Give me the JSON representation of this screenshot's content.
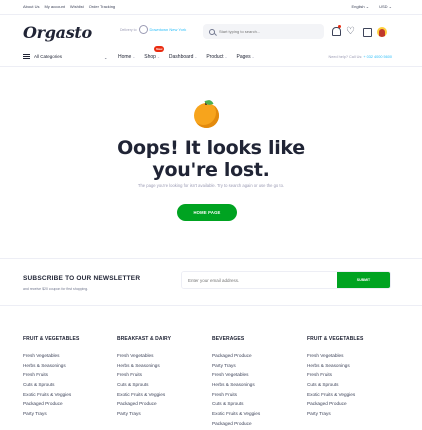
{
  "topbar": {
    "links": [
      "About Us",
      "My account",
      "Wishlist",
      "Order Tracking"
    ],
    "language": "English",
    "currency": "USD"
  },
  "header": {
    "logo": "Orgasto",
    "delivery_label": "Delivery to",
    "delivery_city": "Downtown New York",
    "search_placeholder": "Start typing to search...",
    "avatar_alt": "User avatar"
  },
  "nav": {
    "all_categories": "All Categories",
    "items": [
      {
        "label": "Home",
        "has_dropdown": true
      },
      {
        "label": "Shop",
        "has_dropdown": true,
        "badge": "New"
      },
      {
        "label": "Dashboard",
        "has_dropdown": true
      },
      {
        "label": "Product",
        "has_dropdown": true
      },
      {
        "label": "Pages",
        "has_dropdown": true
      }
    ],
    "help_label": "Need help? Call Us:",
    "help_phone": "+ 032 4000 5600"
  },
  "error": {
    "heading": "Oops! It looks like you're lost.",
    "message": "The page you're looking for isn't available. Try to search again or use the go to.",
    "button": "HOME PAGE"
  },
  "newsletter": {
    "title": "SUBSCRIBE TO OUR NEWSLETTER",
    "desc": "and receive $20 coupon for first shopping.",
    "placeholder": "Enter your email address.",
    "button": "SUBMIT"
  },
  "footer": {
    "columns": [
      {
        "title": "FRUIT & VEGETABLES",
        "items": [
          "Fresh Vegetables",
          "Herbs & Seasonings",
          "Fresh Fruits",
          "Cuts & Sprouts",
          "Exotic Fruits & Veggies",
          "Packaged Produce",
          "Party Trays"
        ]
      },
      {
        "title": "BREAKFAST & DAIRY",
        "items": [
          "Fresh Vegetables",
          "Herbs & Seasonings",
          "Fresh Fruits",
          "Cuts & Sprouts",
          "Exotic Fruits & Veggies",
          "Packaged Produce",
          "Party Trays"
        ]
      },
      {
        "title": "BEVERAGES",
        "items": [
          "Packaged Produce",
          "Party Trays",
          "Fresh Vegetables",
          "Herbs & Seasonings",
          "Fresh Fruits",
          "Cuts & Sprouts",
          "Exotic Fruits & Veggies",
          "Packaged Produce"
        ]
      },
      {
        "title": "FRUIT & VEGETABLES",
        "items": [
          "Fresh Vegetables",
          "Herbs & Seasonings",
          "Fresh Fruits",
          "Cuts & Sprouts",
          "Exotic Fruits & Veggies",
          "Packaged Produce",
          "Party Trays"
        ]
      }
    ]
  },
  "colors": {
    "primary_green": "#00a321",
    "accent_blue": "#2bbef9",
    "badge_red": "#ea2b0f",
    "text_dark": "#202435"
  },
  "icons": [
    "location-pin-icon",
    "search-icon",
    "bell-icon",
    "heart-icon",
    "cart-icon",
    "menu-icon",
    "chevron-down-icon",
    "orange-illustration"
  ]
}
